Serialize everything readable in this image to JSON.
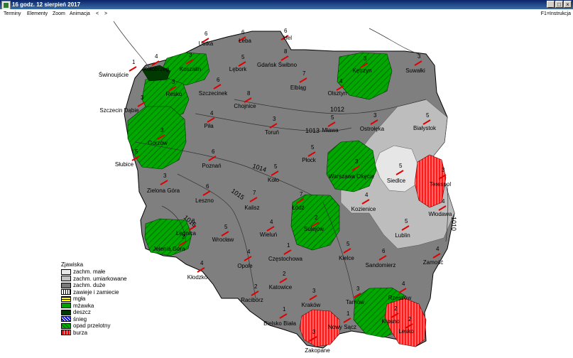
{
  "window": {
    "title": "16 godz. 12 sierpień 2017",
    "btn_min": "_",
    "btn_max": "□",
    "btn_close": "×"
  },
  "menu": {
    "items": [
      "Terminy",
      "Elementy",
      "Zoom",
      "Animacja",
      "<",
      ">"
    ],
    "help": "F1=Instrukcja"
  },
  "legend": {
    "title": "Zjawiska",
    "items": [
      {
        "label": "zachm. małe",
        "color": "#e8e8e8"
      },
      {
        "label": "zachm. umiarkowane",
        "color": "#c0c0c0"
      },
      {
        "label": "zachm. duże",
        "color": "#7a7a7a"
      },
      {
        "label": "zawieje i zamiecie",
        "color": "#ffffff"
      },
      {
        "label": "mgła",
        "color": "#ffff00"
      },
      {
        "label": "mżawka",
        "color": "#00a000"
      },
      {
        "label": "deszcz",
        "color": "#003a00"
      },
      {
        "label": "śnieg",
        "color": "#0000ff"
      },
      {
        "label": "opad przelotny",
        "color": "#00b000"
      },
      {
        "label": "burza",
        "color": "#ff0000"
      }
    ]
  },
  "isobars": [
    "1012",
    "1013",
    "1014",
    "1015",
    "1016",
    "1010"
  ],
  "cities": [
    {
      "name": "Hel",
      "num": "6"
    },
    {
      "name": "Łeba",
      "num": "6"
    },
    {
      "name": "Ustka",
      "num": "6"
    },
    {
      "name": "Kołobrzeg",
      "num": "4"
    },
    {
      "name": "Koszalin",
      "num": "3"
    },
    {
      "name": "Świnoujście",
      "num": "1"
    },
    {
      "name": "Resko",
      "num": "3"
    },
    {
      "name": "Lębork",
      "num": "5"
    },
    {
      "name": "Gdańsk Świbno",
      "num": "8"
    },
    {
      "name": "Kętrzyn",
      "num": "3"
    },
    {
      "name": "Suwałki",
      "num": "3"
    },
    {
      "name": "Elbląg",
      "num": "7"
    },
    {
      "name": "Olsztyn",
      "num": "4"
    },
    {
      "name": "Szczecinek",
      "num": "6"
    },
    {
      "name": "Chojnice",
      "num": "8"
    },
    {
      "name": "Szczecin Dąbie",
      "num": "3"
    },
    {
      "name": "Gorzów",
      "num": "3"
    },
    {
      "name": "Piła",
      "num": "4"
    },
    {
      "name": "Toruń",
      "num": "3"
    },
    {
      "name": "Mława",
      "num": "5"
    },
    {
      "name": "Ostrołęka",
      "num": "3"
    },
    {
      "name": "Białystok",
      "num": "5"
    },
    {
      "name": "Słubice",
      "num": "5"
    },
    {
      "name": "Poznań",
      "num": "6"
    },
    {
      "name": "Płock",
      "num": "5"
    },
    {
      "name": "Warszawa Okęcie",
      "num": "3"
    },
    {
      "name": "Siedlce",
      "num": "5"
    },
    {
      "name": "Terespol",
      "num": "3"
    },
    {
      "name": "Koło",
      "num": "5"
    },
    {
      "name": "Zielona Góra",
      "num": "3"
    },
    {
      "name": "Leszno",
      "num": "6"
    },
    {
      "name": "Kalisz",
      "num": "7"
    },
    {
      "name": "Łódź",
      "num": "7"
    },
    {
      "name": "Kozienice",
      "num": "4"
    },
    {
      "name": "Włodawa",
      "num": "4"
    },
    {
      "name": "Sulejów",
      "num": "2"
    },
    {
      "name": "Legnica",
      "num": "3"
    },
    {
      "name": "Wrocław",
      "num": "5"
    },
    {
      "name": "Wieluń",
      "num": "4"
    },
    {
      "name": "Lublin",
      "num": "5"
    },
    {
      "name": "Jelenia Góra",
      "num": "2"
    },
    {
      "name": "Opole",
      "num": "4"
    },
    {
      "name": "Częstochowa",
      "num": "1"
    },
    {
      "name": "Kielce",
      "num": "5"
    },
    {
      "name": "Sandomierz",
      "num": "6"
    },
    {
      "name": "Zamość",
      "num": "4"
    },
    {
      "name": "Kłodzko",
      "num": "4"
    },
    {
      "name": "Katowice",
      "num": "2"
    },
    {
      "name": "Racibórz",
      "num": "2"
    },
    {
      "name": "Kraków",
      "num": "3"
    },
    {
      "name": "Tarnów",
      "num": "3"
    },
    {
      "name": "Rzeszów",
      "num": "4"
    },
    {
      "name": "Krosno",
      "num": "2"
    },
    {
      "name": "Lesko",
      "num": "2"
    },
    {
      "name": "Bielsko Biała",
      "num": "1"
    },
    {
      "name": "Nowy Sącz",
      "num": "1"
    },
    {
      "name": "Zakopane",
      "num": "3"
    }
  ]
}
